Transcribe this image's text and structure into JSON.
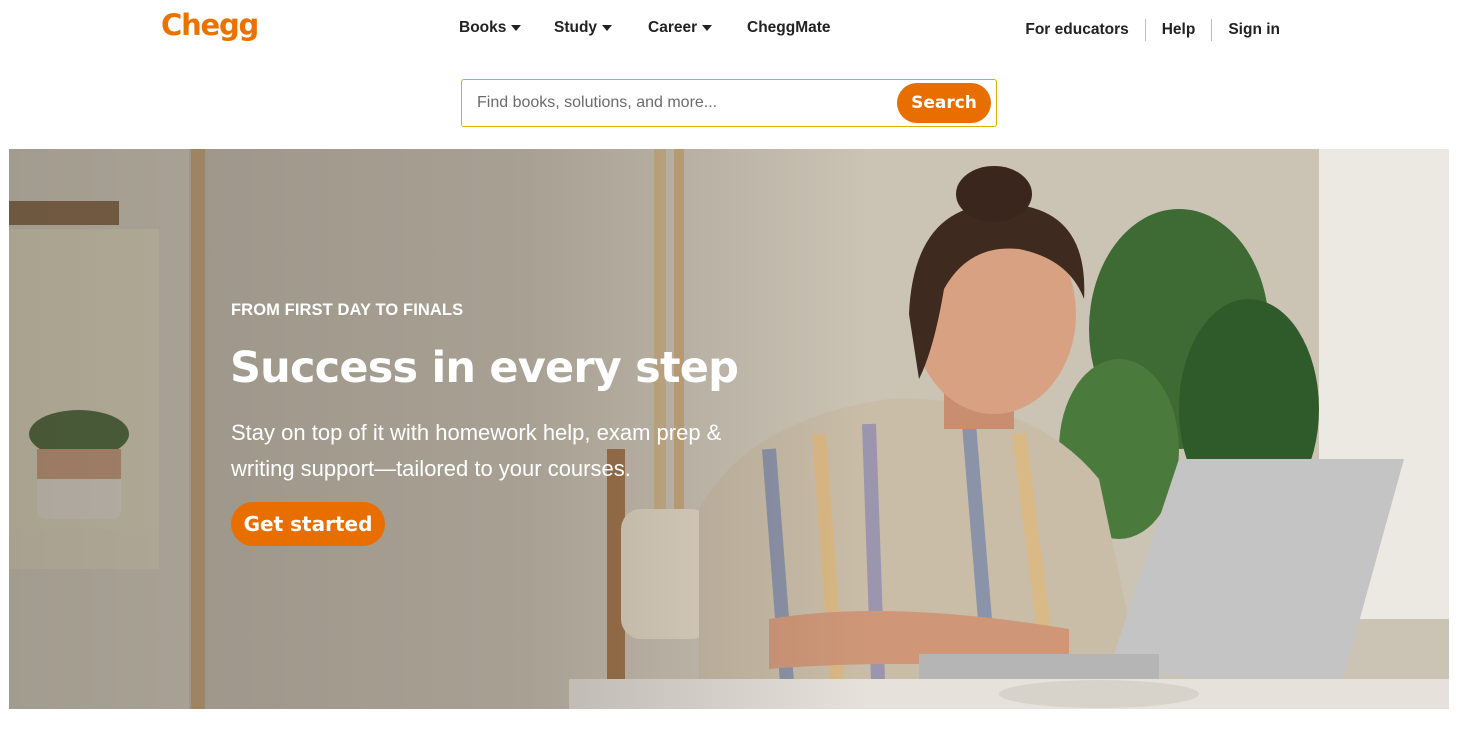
{
  "brand": {
    "logo_text": "Chegg",
    "accent": "#e86e00"
  },
  "nav": {
    "items": [
      {
        "label": "Books",
        "has_dropdown": true
      },
      {
        "label": "Study",
        "has_dropdown": true
      },
      {
        "label": "Career",
        "has_dropdown": true
      },
      {
        "label": "CheggMate",
        "has_dropdown": false
      }
    ],
    "right": {
      "educators": "For educators",
      "help": "Help",
      "signin": "Sign in"
    }
  },
  "search": {
    "placeholder": "Find books, solutions, and more...",
    "value": "",
    "button_label": "Search"
  },
  "hero": {
    "eyebrow": "FROM FIRST DAY TO FINALS",
    "headline": "Success in every step",
    "subtext": "Stay on top of it with homework help, exam prep & writing support—tailored to your courses.",
    "cta_label": "Get started"
  }
}
